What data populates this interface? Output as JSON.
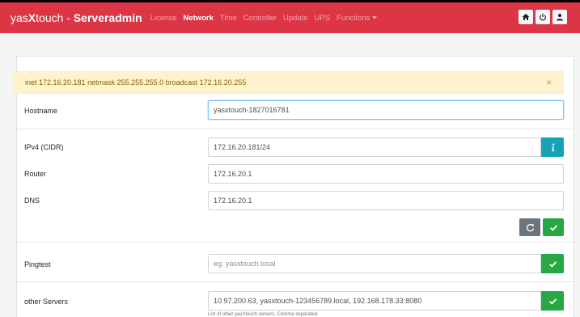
{
  "navbar": {
    "brand_prefix": "yas",
    "brand_x": "X",
    "brand_suffix": "touch - ",
    "brand_app": "Serveradmin",
    "links": [
      "License",
      "Network",
      "Time",
      "Controller",
      "Update",
      "UPS",
      "Functions"
    ],
    "active_link": "Network",
    "buttons": [
      "home-icon",
      "power-icon",
      "user-icon"
    ]
  },
  "alert": {
    "text": "inet 172.16.20.181 netmask 255.255.255.0 broadcast 172.16.20.255",
    "close": "×"
  },
  "form": {
    "hostname_label": "Hostname",
    "hostname_value": "yasxtouch-1827016781",
    "ipv4_label": "IPv4 (CIDR)",
    "ipv4_value": "172.16.20.181/24",
    "router_label": "Router",
    "router_value": "172.16.20.1",
    "dns_label": "DNS",
    "dns_value": "172.16.20.1",
    "pingtest_label": "Pingtest",
    "pingtest_placeholder": "eg. yasxtouch.local",
    "servers_label": "other Servers",
    "servers_value": "10.97.200.63, yasxtouch-123456789.local, 192.168.178.33:8080",
    "servers_help": "List of other yasXtouch servers. Comma separated."
  },
  "colors": {
    "navbar": "#dc3545",
    "alert_bg": "#fff3cd",
    "info": "#17a2b8",
    "success": "#28a745",
    "secondary": "#6c757d"
  }
}
